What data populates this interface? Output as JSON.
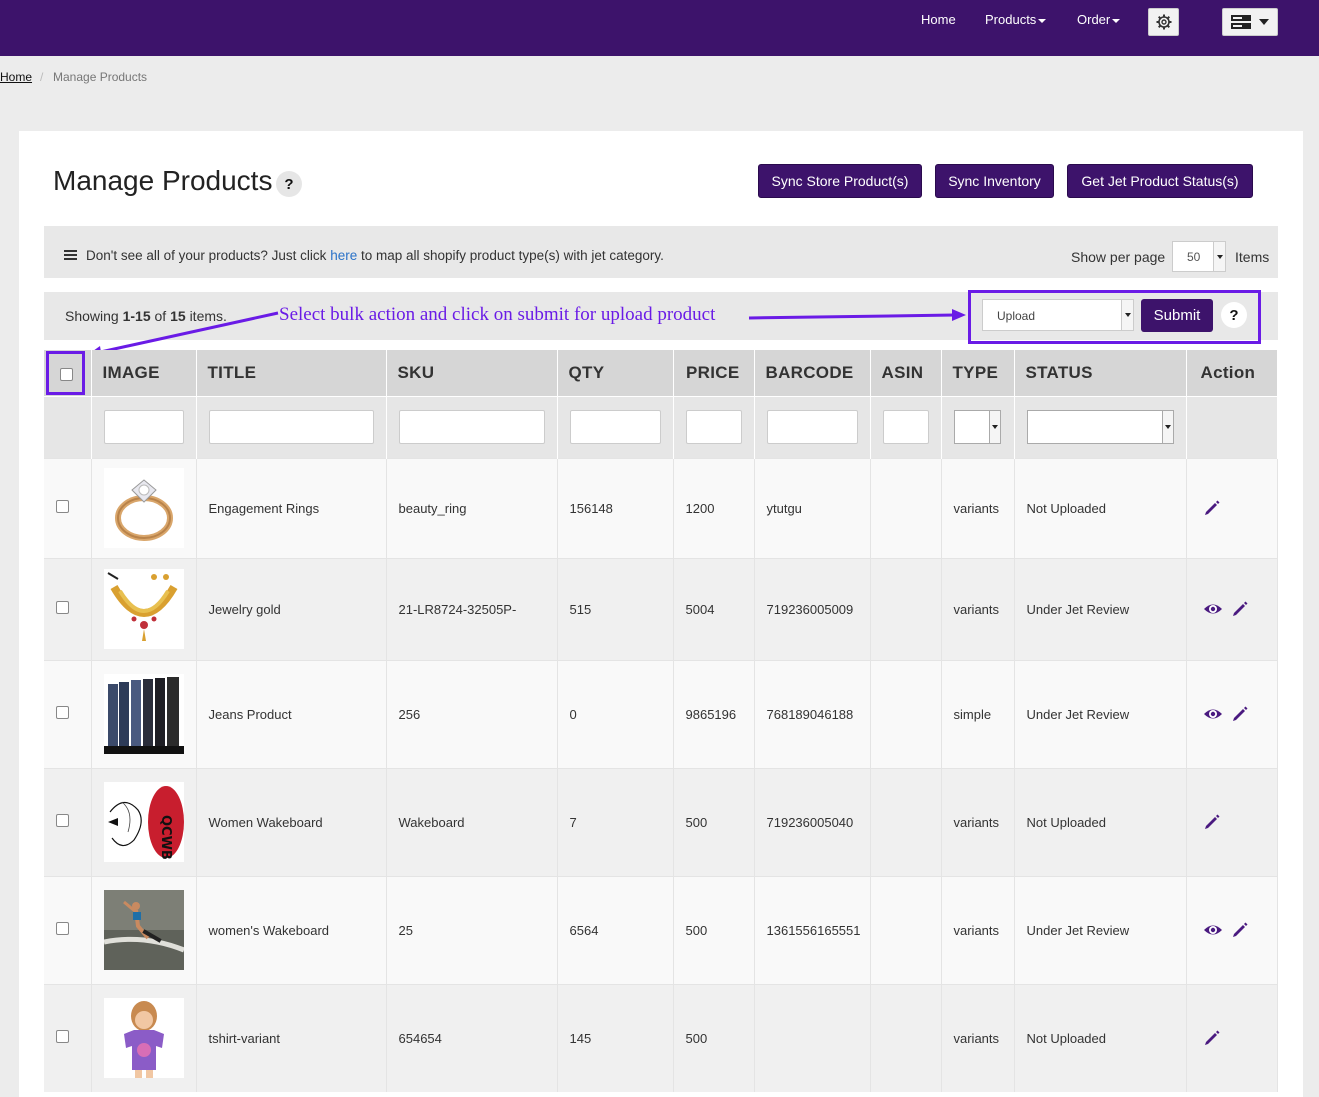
{
  "nav": {
    "home": "Home",
    "products": "Products",
    "order": "Order",
    "gear_icon": "gear-icon",
    "menu_icon": "server-icon"
  },
  "breadcrumb": {
    "home": "Home",
    "separator": "/",
    "current": "Manage Products"
  },
  "page": {
    "title": "Manage Products",
    "help": "?"
  },
  "actions": {
    "sync_store": "Sync Store Product(s)",
    "sync_inventory": "Sync Inventory",
    "get_status": "Get Jet Product Status(s)"
  },
  "info": {
    "text_before": "Don't see all of your products? Just click",
    "link": "here",
    "text_after": "to map all shopify product type(s) with jet category.",
    "per_page_label": "Show per page",
    "per_page_value": "50",
    "items_label": "Items"
  },
  "showing": {
    "prefix": "Showing",
    "range": "1-15",
    "of": "of",
    "total": "15",
    "suffix": "items."
  },
  "annotation": "Select bulk action and click on submit for upload product",
  "bulk": {
    "selected": "Upload",
    "submit": "Submit",
    "help": "?"
  },
  "colors": {
    "nav_bg": "#3d136b",
    "accent": "#6a1be6",
    "link": "#2a72c8"
  },
  "table": {
    "headers": [
      "IMAGE",
      "TITLE",
      "SKU",
      "QTY",
      "PRICE",
      "BARCODE",
      "ASIN",
      "TYPE",
      "STATUS",
      "Action"
    ],
    "rows": [
      {
        "title": "Engagement Rings",
        "sku": "beauty_ring",
        "qty": "156148",
        "price": "1200",
        "barcode": "ytutgu",
        "asin": "",
        "type": "variants",
        "status": "Not Uploaded",
        "image": "ring-image",
        "view": false
      },
      {
        "title": "Jewelry gold",
        "sku": "21-LR8724-32505P-",
        "qty": "515",
        "price": "5004",
        "barcode": "719236005009",
        "asin": "",
        "type": "variants",
        "status": "Under Jet Review",
        "image": "necklace-image",
        "view": true
      },
      {
        "title": "Jeans Product",
        "sku": "256",
        "qty": "0",
        "price": "9865196",
        "barcode": "768189046188",
        "asin": "",
        "type": "simple",
        "status": "Under Jet Review",
        "image": "jeans-image",
        "view": true
      },
      {
        "title": "Women Wakeboard",
        "sku": "Wakeboard",
        "qty": "7",
        "price": "500",
        "barcode": "719236005040",
        "asin": "",
        "type": "variants",
        "status": "Not Uploaded",
        "image": "wakeboard-image",
        "view": false
      },
      {
        "title": "women's Wakeboard",
        "sku": "25",
        "qty": "6564",
        "price": "500",
        "barcode": "1361556165551",
        "asin": "",
        "type": "variants",
        "status": "Under Jet Review",
        "image": "wakeboarder-image",
        "view": true
      },
      {
        "title": "tshirt-variant",
        "sku": "654654",
        "qty": "145",
        "price": "500",
        "barcode": "",
        "asin": "",
        "type": "variants",
        "status": "Not Uploaded",
        "image": "girl-tshirt-image",
        "view": false
      }
    ]
  }
}
